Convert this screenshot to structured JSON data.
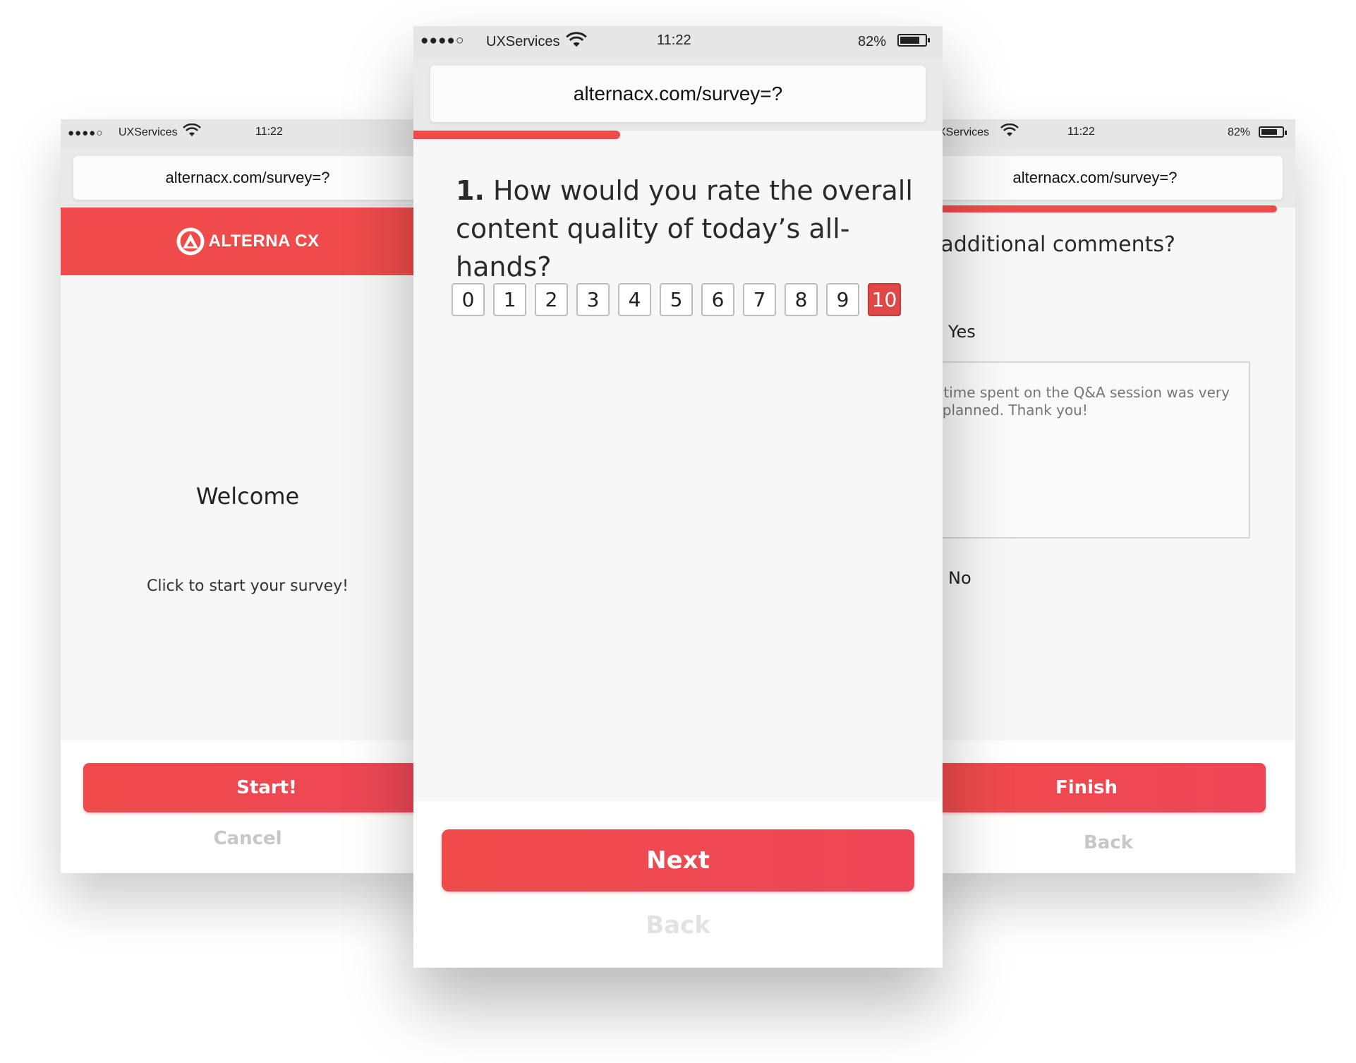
{
  "status": {
    "signal": "●●●●○",
    "carrier": "UXServices",
    "time": "11:22",
    "battery": "82%",
    "battery_level": 0.82
  },
  "url": "alternacx.com/survey=?",
  "colors": {
    "accent": "#ef4b4b",
    "selected": "#e04848"
  },
  "welcome_screen": {
    "brand": "ALTERNA CX",
    "title": "Welcome",
    "subtitle": "Click to start your survey!",
    "primary_label": "Start!",
    "secondary_label": "Cancel"
  },
  "question_screen": {
    "progress": 0.39,
    "number": "1.",
    "text": "How would you rate the overall content quality of today’s all-hands?",
    "options": [
      "0",
      "1",
      "2",
      "3",
      "4",
      "5",
      "6",
      "7",
      "8",
      "9",
      "10"
    ],
    "selected": "10",
    "primary_label": "Next",
    "secondary_label": "Back"
  },
  "comments_screen": {
    "carrier": "XServices",
    "progress": 0.95,
    "question": "ny additional comments?",
    "option_yes": "Yes",
    "option_no": "No",
    "comment": "he time spent on the Q&A session was very\nell planned. Thank you!",
    "primary_label": "Finish",
    "secondary_label": "Back"
  }
}
